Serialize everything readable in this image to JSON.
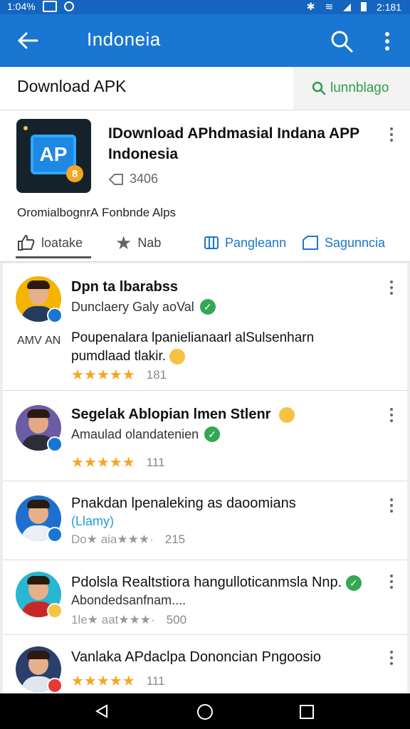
{
  "status_bar": {
    "time_left": "1:04%",
    "time_right": "2:181"
  },
  "app_bar": {
    "title": "Indoneia"
  },
  "sub_bar": {
    "left": "Download APK",
    "right": "lunnblago"
  },
  "app": {
    "name_line1": "IDownload APhdmasial Indana APP",
    "name_line2": "Indonesia",
    "meta": "3406",
    "icon_text": "AP",
    "icon_badge": "8",
    "description": "OromialbognrА Fonbnde Alps"
  },
  "tabs": [
    {
      "label": "loatake",
      "icon": "thumbs-up-icon"
    },
    {
      "label": "Nab",
      "icon": "star-icon"
    },
    {
      "label": "Pangleann",
      "icon": "columns-icon"
    },
    {
      "label": "Sagunncia",
      "icon": "tag-icon"
    }
  ],
  "reviews": [
    {
      "name": "Dpn ta lbarabss",
      "sub": "Dunclaery Galy aoVal",
      "side_label": "АΜV АΝ",
      "text_line1": "Poupenalara lpanielianaarl alSulsenharn",
      "text_line2": "pumdlaad tlakir.",
      "stars": "★★★★★",
      "count": "181"
    },
    {
      "name": "Segelak Ablopian lmen Stlenr",
      "sub": "Amaulad olandatenien",
      "stars": "★★★★★",
      "count": "111"
    },
    {
      "name": "Pnakdan lpenaleking as daoomians",
      "sub": "(Llamy)",
      "prefix": "Do★ aia★★★·",
      "count": "215"
    },
    {
      "name": "Pdolsla Realtstiora hangulloticanmsla Nnp.",
      "sub": "Abondedsanfnam....",
      "prefix": "1le★ aat★★★·",
      "count": "500"
    },
    {
      "name": "Vanlaka APdaclpa Dononcian Pngoosio",
      "stars": "★★★★★",
      "count": "111"
    }
  ],
  "colors": {
    "primary": "#1976d2",
    "status": "#1565c0",
    "green": "#2e9d4a",
    "star": "#f5a623"
  }
}
